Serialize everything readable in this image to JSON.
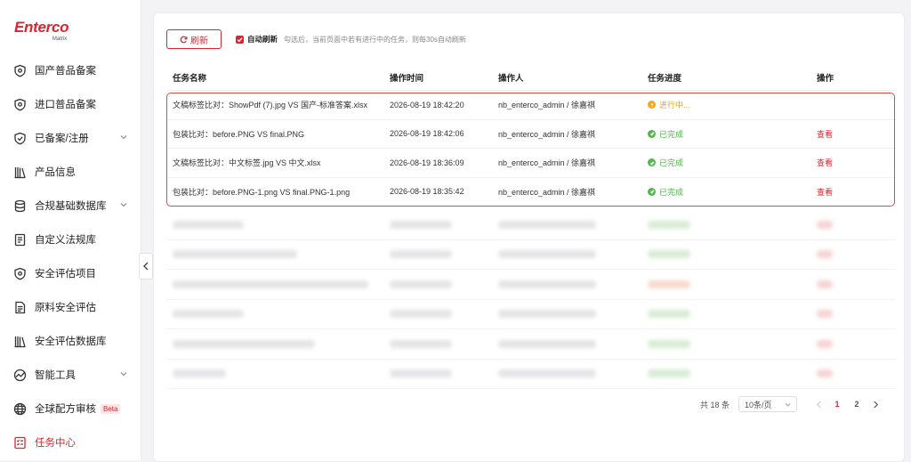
{
  "brand": {
    "name": "Enterco",
    "sub": "Matrix",
    "accent": "#d9252f"
  },
  "sidebar": {
    "items": [
      {
        "label": "国产普品备案",
        "icon": "shield-icon"
      },
      {
        "label": "进口普品备案",
        "icon": "shield-icon"
      },
      {
        "label": "已备案/注册",
        "icon": "shield-check-icon",
        "expandable": true
      },
      {
        "label": "产品信息",
        "icon": "library-icon"
      },
      {
        "label": "合规基础数据库",
        "icon": "database-icon",
        "expandable": true
      },
      {
        "label": "自定义法规库",
        "icon": "law-book-icon"
      },
      {
        "label": "安全评估项目",
        "icon": "shield-icon"
      },
      {
        "label": "原料安全评估",
        "icon": "document-icon"
      },
      {
        "label": "安全评估数据库",
        "icon": "library-icon"
      },
      {
        "label": "智能工具",
        "icon": "chart-icon",
        "expandable": true
      },
      {
        "label": "全球配方审核",
        "icon": "globe-icon",
        "badge": "Beta"
      },
      {
        "label": "任务中心",
        "icon": "task-list-icon",
        "active": true
      }
    ]
  },
  "toolbar": {
    "refresh_label": "刷新",
    "auto_refresh_label": "自动刷新",
    "auto_refresh_hint": "勾选后，当前页面中若有进行中的任务，则每30s自动刷新"
  },
  "table": {
    "headers": [
      "任务名称",
      "操作时间",
      "操作人",
      "任务进度",
      "操作"
    ],
    "rows": [
      {
        "name": "文稿标签比对：ShowPdf (7).jpg VS 国产-标准答案.xlsx",
        "time": "2026-08-19 18:42:20",
        "user": "nb_enterco_admin / 徐嘉祺",
        "status": "进行中...",
        "status_type": "progress",
        "action": ""
      },
      {
        "name": "包装比对：before.PNG VS final.PNG",
        "time": "2026-08-19 18:42:06",
        "user": "nb_enterco_admin / 徐嘉祺",
        "status": "已完成",
        "status_type": "done",
        "action": "查看"
      },
      {
        "name": "文稿标签比对：中文标签.jpg VS 中文.xlsx",
        "time": "2026-08-19 18:36:09",
        "user": "nb_enterco_admin / 徐嘉祺",
        "status": "已完成",
        "status_type": "done",
        "action": "查看"
      },
      {
        "name": "包装比对：before.PNG-1.png VS final.PNG-1.png",
        "time": "2026-08-19 18:35:42",
        "user": "nb_enterco_admin / 徐嘉祺",
        "status": "已完成",
        "status_type": "done",
        "action": "查看"
      }
    ]
  },
  "pagination": {
    "total_text": "共 18 条",
    "page_size": "10条/页",
    "pages": [
      "1",
      "2"
    ],
    "current_page": "1"
  }
}
